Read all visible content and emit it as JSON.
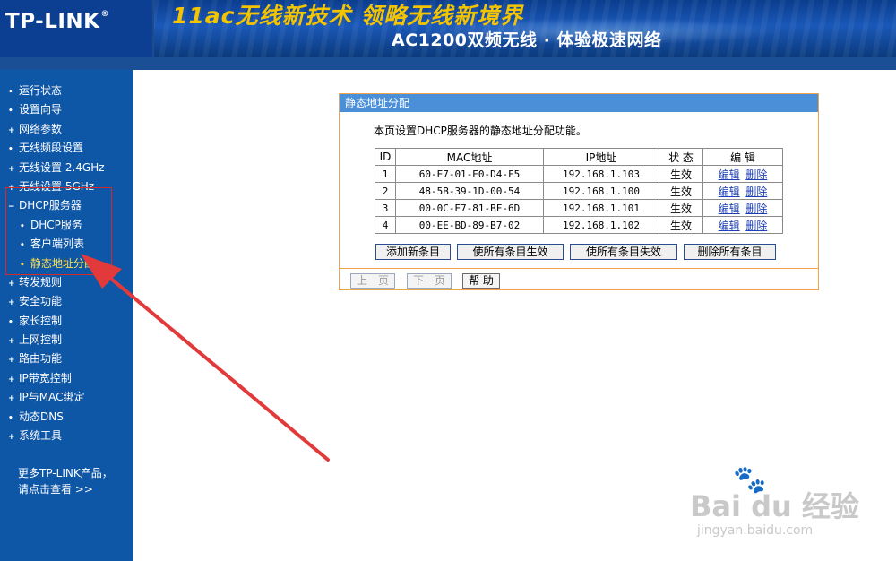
{
  "header": {
    "logo": "TP-LINK",
    "logo_reg": "®",
    "banner_line1": "11ac无线新技术 领略无线新境界",
    "banner_line2": "AC1200双频无线 · 体验极速网络"
  },
  "sidebar": {
    "items": [
      {
        "label": "运行状态",
        "icon": "•"
      },
      {
        "label": "设置向导",
        "icon": "•"
      },
      {
        "label": "网络参数",
        "icon": "+"
      },
      {
        "label": "无线频段设置",
        "icon": "•"
      },
      {
        "label": "无线设置 2.4GHz",
        "icon": "+"
      },
      {
        "label": "无线设置 5GHz",
        "icon": "+"
      },
      {
        "label": "DHCP服务器",
        "icon": "−"
      },
      {
        "label": "DHCP服务",
        "icon": "•"
      },
      {
        "label": "客户端列表",
        "icon": "•"
      },
      {
        "label": "静态地址分配",
        "icon": "•"
      },
      {
        "label": "转发规则",
        "icon": "+"
      },
      {
        "label": "安全功能",
        "icon": "+"
      },
      {
        "label": "家长控制",
        "icon": "•"
      },
      {
        "label": "上网控制",
        "icon": "+"
      },
      {
        "label": "路由功能",
        "icon": "+"
      },
      {
        "label": "IP带宽控制",
        "icon": "+"
      },
      {
        "label": "IP与MAC绑定",
        "icon": "+"
      },
      {
        "label": "动态DNS",
        "icon": "•"
      },
      {
        "label": "系统工具",
        "icon": "+"
      }
    ],
    "more_line1": "更多TP-LINK产品，",
    "more_line2": "请点击查看 >>"
  },
  "panel": {
    "title": "静态地址分配",
    "description": "本页设置DHCP服务器的静态地址分配功能。",
    "columns": [
      "ID",
      "MAC地址",
      "IP地址",
      "状 态",
      "编 辑"
    ],
    "rows": [
      {
        "id": "1",
        "mac": "60-E7-01-E0-D4-F5",
        "ip": "192.168.1.103",
        "status": "生效",
        "edit": "编辑",
        "delete": "删除"
      },
      {
        "id": "2",
        "mac": "48-5B-39-1D-00-54",
        "ip": "192.168.1.100",
        "status": "生效",
        "edit": "编辑",
        "delete": "删除"
      },
      {
        "id": "3",
        "mac": "00-0C-E7-81-BF-6D",
        "ip": "192.168.1.101",
        "status": "生效",
        "edit": "编辑",
        "delete": "删除"
      },
      {
        "id": "4",
        "mac": "00-EE-BD-89-B7-02",
        "ip": "192.168.1.102",
        "status": "生效",
        "edit": "编辑",
        "delete": "删除"
      }
    ],
    "buttons": {
      "add": "添加新条目",
      "enable_all": "使所有条目生效",
      "disable_all": "使所有条目失效",
      "delete_all": "删除所有条目"
    },
    "pager": {
      "prev": "上一页",
      "next": "下一页",
      "help": "帮 助"
    }
  },
  "watermark": {
    "text": "Bai du 经验",
    "url": "jingyan.baidu.com"
  },
  "colors": {
    "sidebar_bg": "#0e56a6",
    "panel_border": "#f0a34a",
    "panel_title_bg": "#4a8fd8",
    "annotation_red": "#e23a3a",
    "active_item": "#ffe14d"
  }
}
